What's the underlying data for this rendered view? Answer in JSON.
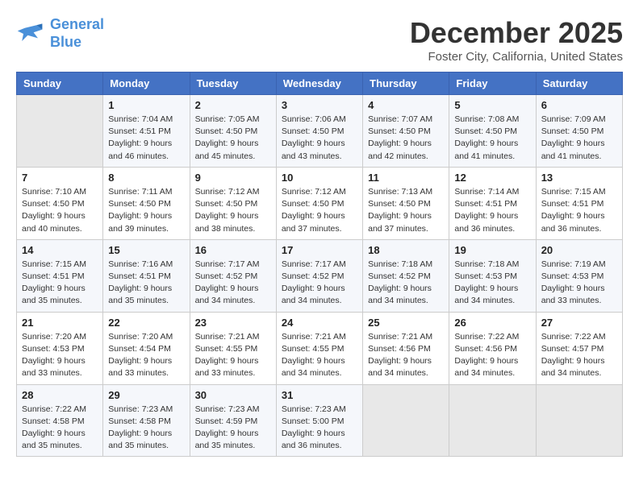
{
  "header": {
    "logo_line1": "General",
    "logo_line2": "Blue",
    "month": "December 2025",
    "location": "Foster City, California, United States"
  },
  "weekdays": [
    "Sunday",
    "Monday",
    "Tuesday",
    "Wednesday",
    "Thursday",
    "Friday",
    "Saturday"
  ],
  "weeks": [
    [
      {
        "day": "",
        "info": ""
      },
      {
        "day": "1",
        "info": "Sunrise: 7:04 AM\nSunset: 4:51 PM\nDaylight: 9 hours\nand 46 minutes."
      },
      {
        "day": "2",
        "info": "Sunrise: 7:05 AM\nSunset: 4:50 PM\nDaylight: 9 hours\nand 45 minutes."
      },
      {
        "day": "3",
        "info": "Sunrise: 7:06 AM\nSunset: 4:50 PM\nDaylight: 9 hours\nand 43 minutes."
      },
      {
        "day": "4",
        "info": "Sunrise: 7:07 AM\nSunset: 4:50 PM\nDaylight: 9 hours\nand 42 minutes."
      },
      {
        "day": "5",
        "info": "Sunrise: 7:08 AM\nSunset: 4:50 PM\nDaylight: 9 hours\nand 41 minutes."
      },
      {
        "day": "6",
        "info": "Sunrise: 7:09 AM\nSunset: 4:50 PM\nDaylight: 9 hours\nand 41 minutes."
      }
    ],
    [
      {
        "day": "7",
        "info": "Sunrise: 7:10 AM\nSunset: 4:50 PM\nDaylight: 9 hours\nand 40 minutes."
      },
      {
        "day": "8",
        "info": "Sunrise: 7:11 AM\nSunset: 4:50 PM\nDaylight: 9 hours\nand 39 minutes."
      },
      {
        "day": "9",
        "info": "Sunrise: 7:12 AM\nSunset: 4:50 PM\nDaylight: 9 hours\nand 38 minutes."
      },
      {
        "day": "10",
        "info": "Sunrise: 7:12 AM\nSunset: 4:50 PM\nDaylight: 9 hours\nand 37 minutes."
      },
      {
        "day": "11",
        "info": "Sunrise: 7:13 AM\nSunset: 4:50 PM\nDaylight: 9 hours\nand 37 minutes."
      },
      {
        "day": "12",
        "info": "Sunrise: 7:14 AM\nSunset: 4:51 PM\nDaylight: 9 hours\nand 36 minutes."
      },
      {
        "day": "13",
        "info": "Sunrise: 7:15 AM\nSunset: 4:51 PM\nDaylight: 9 hours\nand 36 minutes."
      }
    ],
    [
      {
        "day": "14",
        "info": "Sunrise: 7:15 AM\nSunset: 4:51 PM\nDaylight: 9 hours\nand 35 minutes."
      },
      {
        "day": "15",
        "info": "Sunrise: 7:16 AM\nSunset: 4:51 PM\nDaylight: 9 hours\nand 35 minutes."
      },
      {
        "day": "16",
        "info": "Sunrise: 7:17 AM\nSunset: 4:52 PM\nDaylight: 9 hours\nand 34 minutes."
      },
      {
        "day": "17",
        "info": "Sunrise: 7:17 AM\nSunset: 4:52 PM\nDaylight: 9 hours\nand 34 minutes."
      },
      {
        "day": "18",
        "info": "Sunrise: 7:18 AM\nSunset: 4:52 PM\nDaylight: 9 hours\nand 34 minutes."
      },
      {
        "day": "19",
        "info": "Sunrise: 7:18 AM\nSunset: 4:53 PM\nDaylight: 9 hours\nand 34 minutes."
      },
      {
        "day": "20",
        "info": "Sunrise: 7:19 AM\nSunset: 4:53 PM\nDaylight: 9 hours\nand 33 minutes."
      }
    ],
    [
      {
        "day": "21",
        "info": "Sunrise: 7:20 AM\nSunset: 4:53 PM\nDaylight: 9 hours\nand 33 minutes."
      },
      {
        "day": "22",
        "info": "Sunrise: 7:20 AM\nSunset: 4:54 PM\nDaylight: 9 hours\nand 33 minutes."
      },
      {
        "day": "23",
        "info": "Sunrise: 7:21 AM\nSunset: 4:55 PM\nDaylight: 9 hours\nand 33 minutes."
      },
      {
        "day": "24",
        "info": "Sunrise: 7:21 AM\nSunset: 4:55 PM\nDaylight: 9 hours\nand 34 minutes."
      },
      {
        "day": "25",
        "info": "Sunrise: 7:21 AM\nSunset: 4:56 PM\nDaylight: 9 hours\nand 34 minutes."
      },
      {
        "day": "26",
        "info": "Sunrise: 7:22 AM\nSunset: 4:56 PM\nDaylight: 9 hours\nand 34 minutes."
      },
      {
        "day": "27",
        "info": "Sunrise: 7:22 AM\nSunset: 4:57 PM\nDaylight: 9 hours\nand 34 minutes."
      }
    ],
    [
      {
        "day": "28",
        "info": "Sunrise: 7:22 AM\nSunset: 4:58 PM\nDaylight: 9 hours\nand 35 minutes."
      },
      {
        "day": "29",
        "info": "Sunrise: 7:23 AM\nSunset: 4:58 PM\nDaylight: 9 hours\nand 35 minutes."
      },
      {
        "day": "30",
        "info": "Sunrise: 7:23 AM\nSunset: 4:59 PM\nDaylight: 9 hours\nand 35 minutes."
      },
      {
        "day": "31",
        "info": "Sunrise: 7:23 AM\nSunset: 5:00 PM\nDaylight: 9 hours\nand 36 minutes."
      },
      {
        "day": "",
        "info": ""
      },
      {
        "day": "",
        "info": ""
      },
      {
        "day": "",
        "info": ""
      }
    ]
  ]
}
